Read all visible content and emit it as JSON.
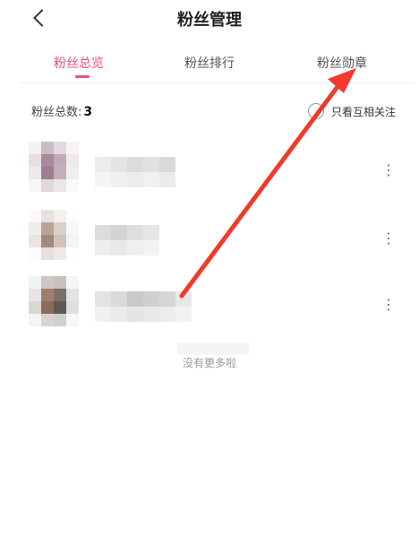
{
  "header": {
    "title": "粉丝管理"
  },
  "tabs": [
    {
      "label": "粉丝总览",
      "active": true
    },
    {
      "label": "粉丝排行",
      "active": false
    },
    {
      "label": "粉丝勋章",
      "active": false
    }
  ],
  "summary": {
    "label": "粉丝总数:",
    "count": "3"
  },
  "mutual_filter": {
    "label": "只看互相关注"
  },
  "fans": [
    {
      "more": "⋮"
    },
    {
      "more": "⋮"
    },
    {
      "more": "⋮"
    }
  ],
  "footer": {
    "no_more": "没有更多啦"
  },
  "colors": {
    "accent": "#e8527a",
    "annotation_arrow": "#f23a2c"
  }
}
